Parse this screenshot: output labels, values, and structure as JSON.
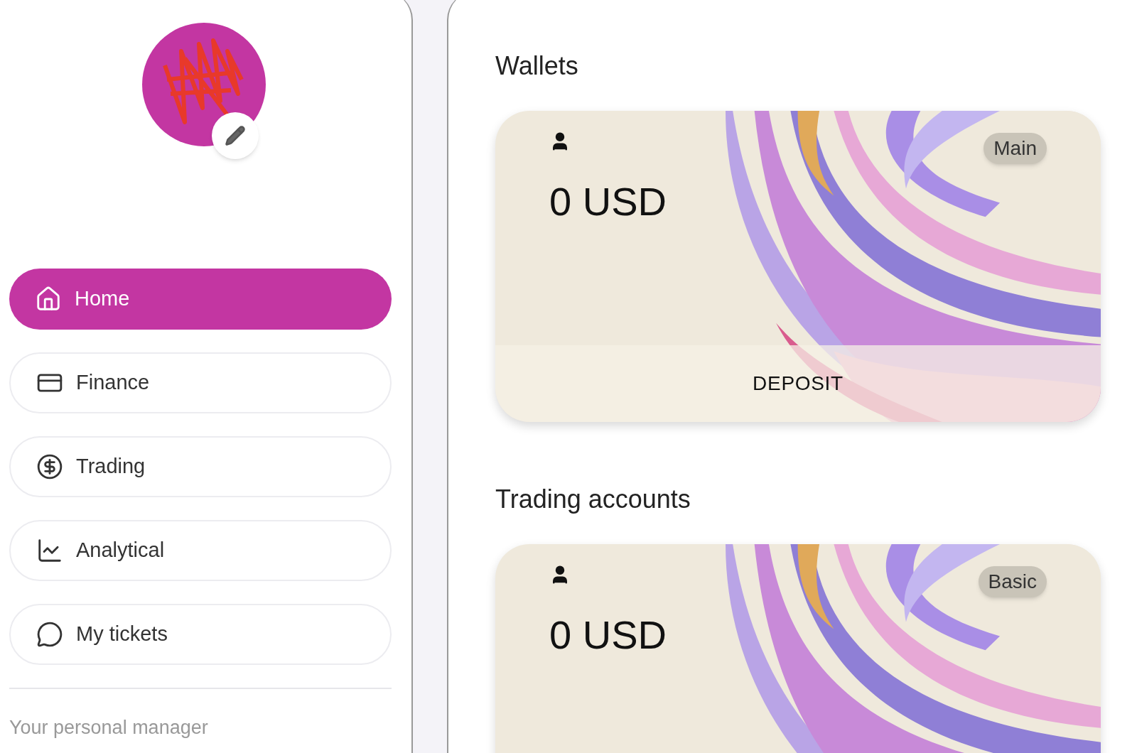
{
  "sidebar": {
    "nav": [
      {
        "label": "Home",
        "selected": true
      },
      {
        "label": "Finance",
        "selected": false
      },
      {
        "label": "Trading",
        "selected": false
      },
      {
        "label": "Analytical",
        "selected": false
      },
      {
        "label": "My tickets",
        "selected": false
      }
    ],
    "manager_label": "Your personal manager"
  },
  "sections": [
    {
      "title": "Wallets",
      "cards": [
        {
          "amount": "0 USD",
          "badge": "Main",
          "action": "DEPOSIT"
        }
      ]
    },
    {
      "title": "Trading accounts",
      "cards": [
        {
          "amount": "0 USD",
          "badge": "Basic"
        }
      ]
    }
  ]
}
